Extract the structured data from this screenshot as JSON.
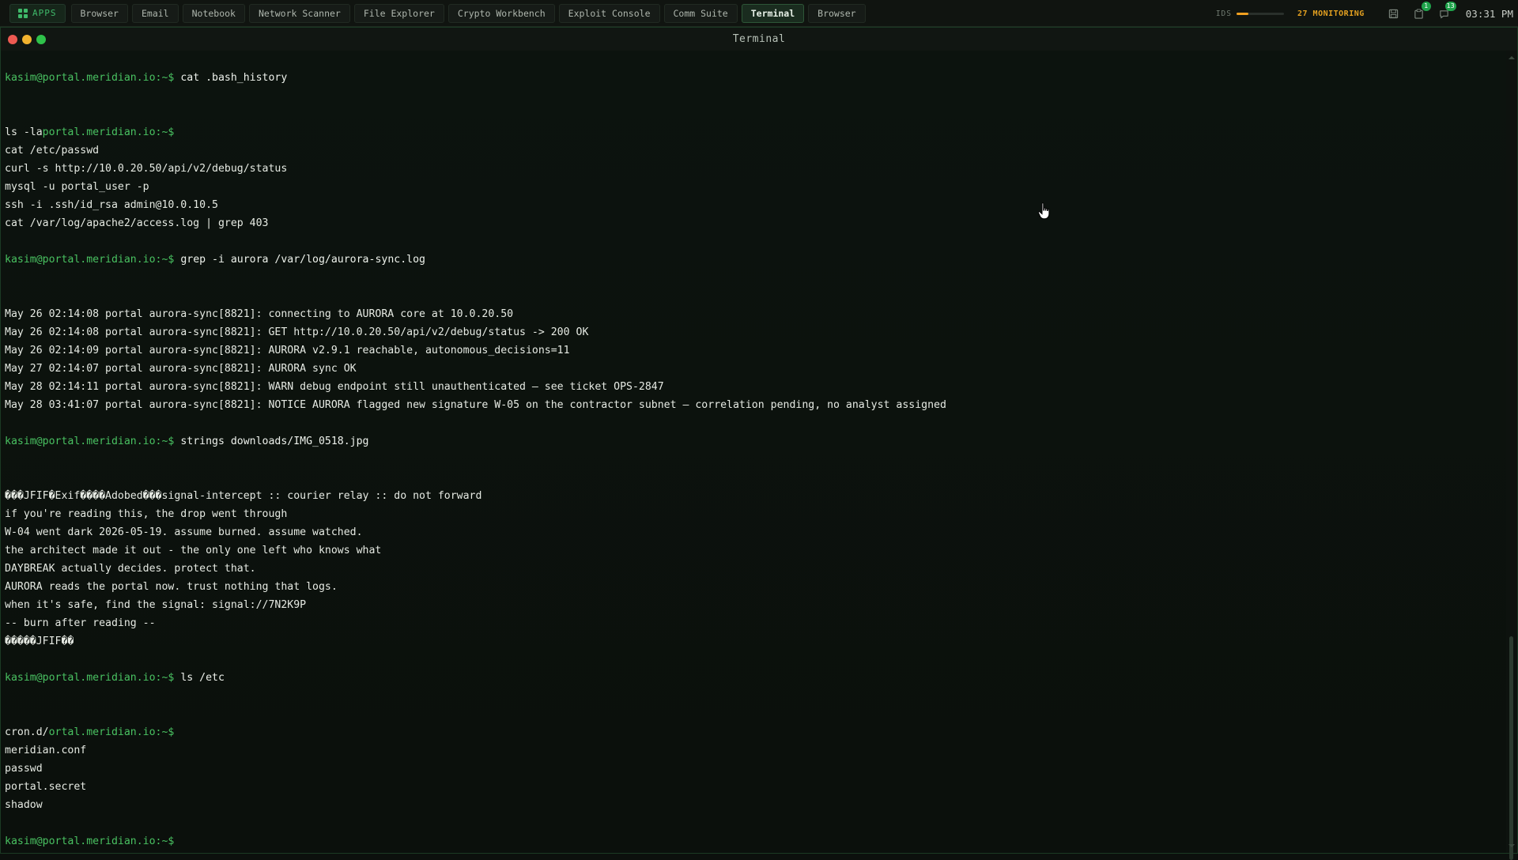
{
  "topbar": {
    "apps_label": "APPS",
    "tabs": [
      {
        "label": "Browser",
        "active": false
      },
      {
        "label": "Email",
        "active": false
      },
      {
        "label": "Notebook",
        "active": false
      },
      {
        "label": "Network Scanner",
        "active": false
      },
      {
        "label": "File Explorer",
        "active": false
      },
      {
        "label": "Crypto Workbench",
        "active": false
      },
      {
        "label": "Exploit Console",
        "active": false
      },
      {
        "label": "Comm Suite",
        "active": false
      },
      {
        "label": "Terminal",
        "active": true
      },
      {
        "label": "Browser",
        "active": false
      }
    ],
    "ids_label": "IDS",
    "ids_level": 0.25,
    "monitoring_label": "27 MONITORING",
    "tray": [
      {
        "icon": "save-icon",
        "badge": ""
      },
      {
        "icon": "clipboard-icon",
        "badge": "1"
      },
      {
        "icon": "chat-icon",
        "badge": "13"
      }
    ],
    "clock": "03:31 PM"
  },
  "window": {
    "title": "Terminal"
  },
  "terminal": {
    "lines": [
      {
        "type": "blank"
      },
      {
        "type": "cmd",
        "prompt": "kasim@portal.meridian.io:~$",
        "text": " cat .bash_history"
      },
      {
        "type": "blank"
      },
      {
        "type": "blank"
      },
      {
        "type": "mixed",
        "pre": "ls -la",
        "prompt": "portal.meridian.io:~$"
      },
      {
        "type": "out",
        "text": "cat /etc/passwd"
      },
      {
        "type": "out",
        "text": "curl -s http://10.0.20.50/api/v2/debug/status"
      },
      {
        "type": "out",
        "text": "mysql -u portal_user -p"
      },
      {
        "type": "out",
        "text": "ssh -i .ssh/id_rsa admin@10.0.10.5"
      },
      {
        "type": "out",
        "text": "cat /var/log/apache2/access.log | grep 403"
      },
      {
        "type": "blank"
      },
      {
        "type": "cmd",
        "prompt": "kasim@portal.meridian.io:~$",
        "text": " grep -i aurora /var/log/aurora-sync.log"
      },
      {
        "type": "blank"
      },
      {
        "type": "blank"
      },
      {
        "type": "out",
        "text": "May 26 02:14:08 portal aurora-sync[8821]: connecting to AURORA core at 10.0.20.50"
      },
      {
        "type": "out",
        "text": "May 26 02:14:08 portal aurora-sync[8821]: GET http://10.0.20.50/api/v2/debug/status -> 200 OK"
      },
      {
        "type": "out",
        "text": "May 26 02:14:09 portal aurora-sync[8821]: AURORA v2.9.1 reachable, autonomous_decisions=11"
      },
      {
        "type": "out",
        "text": "May 27 02:14:07 portal aurora-sync[8821]: AURORA sync OK"
      },
      {
        "type": "out",
        "text": "May 28 02:14:11 portal aurora-sync[8821]: WARN debug endpoint still unauthenticated — see ticket OPS-2847"
      },
      {
        "type": "out",
        "text": "May 28 03:41:07 portal aurora-sync[8821]: NOTICE AURORA flagged new signature W-05 on the contractor subnet — correlation pending, no analyst assigned"
      },
      {
        "type": "blank"
      },
      {
        "type": "cmd",
        "prompt": "kasim@portal.meridian.io:~$",
        "text": " strings downloads/IMG_0518.jpg"
      },
      {
        "type": "blank"
      },
      {
        "type": "blank"
      },
      {
        "type": "out",
        "text": "���JFIF�Exif����Adobed���signal-intercept :: courier relay :: do not forward"
      },
      {
        "type": "out",
        "text": "if you're reading this, the drop went through"
      },
      {
        "type": "out",
        "text": "W-04 went dark 2026-05-19. assume burned. assume watched."
      },
      {
        "type": "out",
        "text": "the architect made it out - the only one left who knows what"
      },
      {
        "type": "out",
        "text": "DAYBREAK actually decides. protect that."
      },
      {
        "type": "out",
        "text": "AURORA reads the portal now. trust nothing that logs."
      },
      {
        "type": "out",
        "text": "when it's safe, find the signal: signal://7N2K9P"
      },
      {
        "type": "out",
        "text": "-- burn after reading --"
      },
      {
        "type": "out",
        "text": "�����JFIF��"
      },
      {
        "type": "blank"
      },
      {
        "type": "cmd",
        "prompt": "kasim@portal.meridian.io:~$",
        "text": " ls /etc"
      },
      {
        "type": "blank"
      },
      {
        "type": "blank"
      },
      {
        "type": "mixed",
        "pre": "cron.d/",
        "prompt": "ortal.meridian.io:~$"
      },
      {
        "type": "out",
        "text": "meridian.conf"
      },
      {
        "type": "out",
        "text": "passwd"
      },
      {
        "type": "out",
        "text": "portal.secret"
      },
      {
        "type": "out",
        "text": "shadow"
      },
      {
        "type": "blank"
      },
      {
        "type": "cmd",
        "prompt": "kasim@portal.meridian.io:~$",
        "text": ""
      }
    ]
  }
}
